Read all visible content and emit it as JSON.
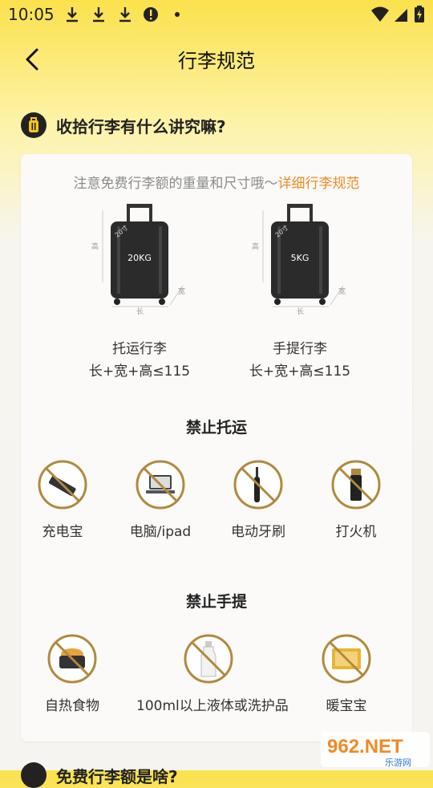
{
  "status_bar": {
    "time": "10:05",
    "icons": [
      "download-icon",
      "download-icon",
      "download-icon",
      "alert-icon",
      "dot-icon",
      "wifi-icon",
      "signal-icon",
      "battery-charging-icon"
    ]
  },
  "nav": {
    "title": "行李规范",
    "back_icon": "chevron-left-icon"
  },
  "section": {
    "title": "收拾行李有什么讲究嘛?",
    "icon": "luggage-icon"
  },
  "notice": {
    "text": "注意免费行李额的重量和尺寸哦～",
    "link": "详细行李规范"
  },
  "baggage": [
    {
      "weight": "20KG",
      "name": "托运行李",
      "rule": "长+宽+高≤115",
      "dim_size": "20寸",
      "dim_h": "高",
      "dim_l": "长",
      "dim_w": "宽"
    },
    {
      "weight": "5KG",
      "name": "手提行李",
      "rule": "长+宽+高≤115",
      "dim_size": "20寸",
      "dim_h": "高",
      "dim_l": "长",
      "dim_w": "宽"
    }
  ],
  "prohibited_checked": {
    "title": "禁止托运",
    "items": [
      {
        "label": "充电宝",
        "icon": "power-bank-icon"
      },
      {
        "label": "电脑/ipad",
        "icon": "laptop-icon"
      },
      {
        "label": "电动牙刷",
        "icon": "electric-toothbrush-icon"
      },
      {
        "label": "打火机",
        "icon": "lighter-icon"
      }
    ]
  },
  "prohibited_carry": {
    "title": "禁止手提",
    "items": [
      {
        "label": "自热食物",
        "icon": "self-heating-food-icon"
      },
      {
        "label": "100ml以上液体或洗护品",
        "icon": "liquid-bottle-icon"
      },
      {
        "label": "暖宝宝",
        "icon": "hand-warmer-icon"
      }
    ]
  },
  "next_section": {
    "title": "免费行李额是啥?"
  },
  "watermark": {
    "brand": "962.NET",
    "sub": "乐游网"
  },
  "colors": {
    "accent": "#F08A24",
    "prohibit": "#B08A3E",
    "header_yellow": "#FBE14C"
  }
}
